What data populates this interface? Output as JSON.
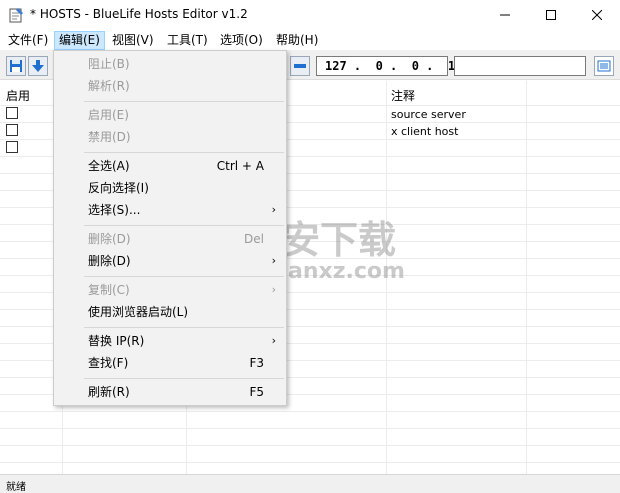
{
  "window": {
    "title": "* HOSTS - BlueLife Hosts Editor v1.2"
  },
  "menubar": {
    "items": [
      "文件(F)",
      "编辑(E)",
      "视图(V)",
      "工具(T)",
      "选项(O)",
      "帮助(H)"
    ],
    "active_index": 1
  },
  "toolbar": {
    "ip_value": "127 .  0 .  0 .  1",
    "hostname_value": ""
  },
  "table": {
    "columns": [
      "启用",
      "注释"
    ],
    "rows": [
      {
        "enabled": false,
        "comment": "source server"
      },
      {
        "enabled": false,
        "comment": "x client host"
      },
      {
        "enabled": false,
        "comment": ""
      }
    ]
  },
  "edit_menu": {
    "items": [
      {
        "label": "阻止(B)",
        "shortcut": "",
        "submenu": false,
        "disabled": true
      },
      {
        "label": "解析(R)",
        "shortcut": "",
        "submenu": false,
        "disabled": true
      },
      {
        "label": "启用(E)",
        "shortcut": "",
        "submenu": false,
        "disabled": true
      },
      {
        "label": "禁用(D)",
        "shortcut": "",
        "submenu": false,
        "disabled": true
      },
      {
        "label": "全选(A)",
        "shortcut": "Ctrl + A",
        "submenu": false,
        "disabled": false
      },
      {
        "label": "反向选择(I)",
        "shortcut": "",
        "submenu": false,
        "disabled": false
      },
      {
        "label": "选择(S)...",
        "shortcut": "",
        "submenu": true,
        "disabled": false
      },
      {
        "label": "删除(D)",
        "shortcut": "Del",
        "submenu": false,
        "disabled": true
      },
      {
        "label": "删除(D)",
        "shortcut": "",
        "submenu": true,
        "disabled": false
      },
      {
        "label": "复制(C)",
        "shortcut": "",
        "submenu": true,
        "disabled": true
      },
      {
        "label": "使用浏览器启动(L)",
        "shortcut": "",
        "submenu": false,
        "disabled": false
      },
      {
        "label": "替换 IP(R)",
        "shortcut": "",
        "submenu": true,
        "disabled": false
      },
      {
        "label": "查找(F)",
        "shortcut": "F3",
        "submenu": false,
        "disabled": false
      },
      {
        "label": "刷新(R)",
        "shortcut": "F5",
        "submenu": false,
        "disabled": false
      }
    ]
  },
  "statusbar": {
    "text": "就绪"
  },
  "watermark": {
    "text": "安下载",
    "subtext": "anxz.com"
  },
  "colors": {
    "menu_active_bg": "#cce8ff",
    "menu_bg": "#f2f2f2",
    "disabled_text": "#9a9a9a",
    "toolbar_icon_blue": "#1f6fd1"
  },
  "icons": {
    "app": "notepad-icon",
    "save": "save-icon",
    "download": "arrow-down-icon",
    "remove": "minus-icon",
    "view": "list-view-icon",
    "submenu": "chevron-right-icon"
  }
}
